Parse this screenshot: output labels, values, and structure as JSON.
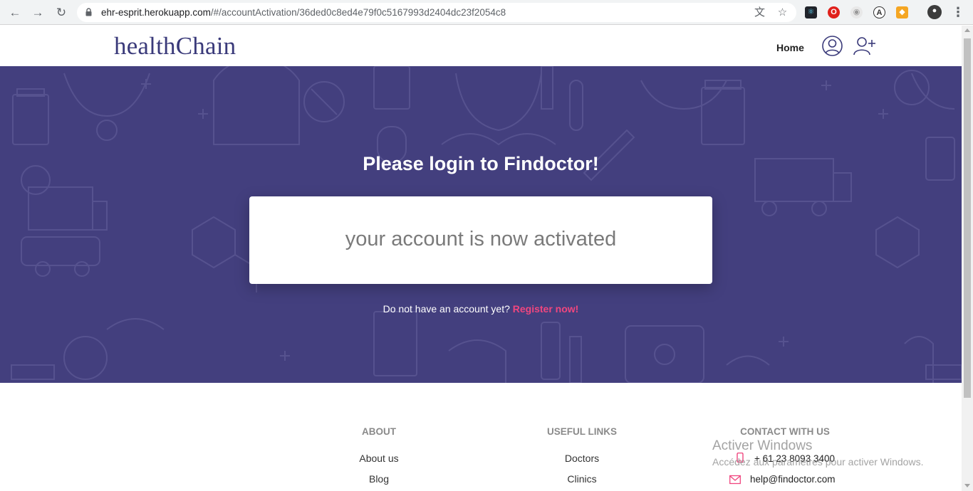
{
  "browser": {
    "url_host": "ehr-esprit.herokuapp.com",
    "url_path": "/#/accountActivation/36ded0c8ed4e79f0c5167993d2404dc23f2054c8"
  },
  "header": {
    "brand": "healthChain",
    "nav_home": "Home"
  },
  "hero": {
    "title": "Please login to Findoctor!",
    "message": "your account is now activated",
    "register_prompt": "Do not have an account yet?",
    "register_link": "Register now!",
    "background_color": "#433f7e",
    "link_color": "#f0467f"
  },
  "footer": {
    "about": {
      "title": "ABOUT",
      "links": [
        "About us",
        "Blog"
      ]
    },
    "useful_links": {
      "title": "USEFUL LINKS",
      "links": [
        "Doctors",
        "Clinics"
      ]
    },
    "contact": {
      "title": "CONTACT WITH US",
      "phone": "+ 61 23 8093 3400",
      "email": "help@findoctor.com"
    }
  },
  "watermark": {
    "title": "Activer Windows",
    "subtitle": "Accédez aux paramètres pour activer Windows."
  }
}
